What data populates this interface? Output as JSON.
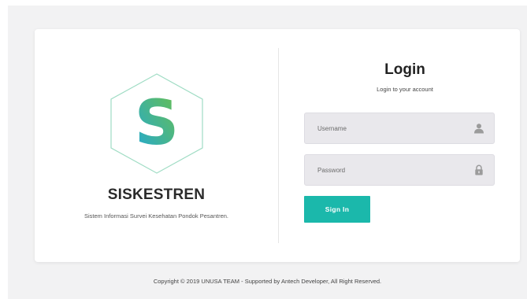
{
  "brand": {
    "logo_letter": "S",
    "name": "SISKESTREN",
    "tagline": "Sistem Informasi Survei Kesehatan Pondok Pesantren."
  },
  "login": {
    "title": "Login",
    "subtitle": "Login to your account",
    "username": {
      "placeholder": "Username",
      "value": "",
      "icon": "user-icon"
    },
    "password": {
      "placeholder": "Password",
      "value": "",
      "icon": "lock-icon"
    },
    "submit_label": "Sign In"
  },
  "footer": {
    "text": "Copyright © 2019 UNUSA TEAM - Supported by Antech Developer, All Right Reserved."
  },
  "colors": {
    "accent": "#1bb8ab",
    "logo_gradient_start": "#1fa8d8",
    "logo_gradient_end": "#6cc04a",
    "hexagon_outline": "#9fdcc4",
    "field_background": "#e9e8ec",
    "page_background": "#f2f2f3"
  }
}
